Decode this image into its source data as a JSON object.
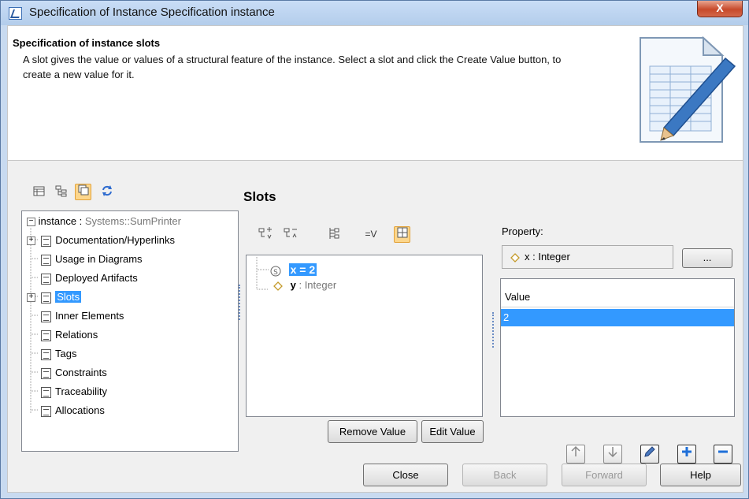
{
  "window": {
    "title": "Specification of Instance Specification instance",
    "close_glyph": "X"
  },
  "header": {
    "title": "Specification of instance slots",
    "description": "A slot gives the value or values of a structural feature of the instance. Select a slot and click the Create Value button, to create a new value for it."
  },
  "toolbar_left": {
    "icons": [
      "table-icon",
      "tree-icon",
      "panel-icon",
      "refresh-icon"
    ]
  },
  "tree": {
    "root_name": "instance",
    "root_sep": " : ",
    "root_type": "Systems::SumPrinter",
    "items": [
      {
        "label": "Documentation/Hyperlinks",
        "expandable": true
      },
      {
        "label": "Usage in Diagrams",
        "expandable": false
      },
      {
        "label": "Deployed Artifacts",
        "expandable": false
      },
      {
        "label": "Slots",
        "expandable": true,
        "selected": true
      },
      {
        "label": "Inner Elements",
        "expandable": false
      },
      {
        "label": "Relations",
        "expandable": false
      },
      {
        "label": "Tags",
        "expandable": false
      },
      {
        "label": "Constraints",
        "expandable": false
      },
      {
        "label": "Traceability",
        "expandable": false
      },
      {
        "label": "Allocations",
        "expandable": false
      }
    ]
  },
  "slots": {
    "title": "Slots",
    "toolbar_value_label": "=V",
    "rows": [
      {
        "name": "x = 2",
        "selected": true
      },
      {
        "name": "y",
        "type": " : Integer"
      }
    ],
    "remove_label": "Remove Value",
    "edit_label": "Edit Value"
  },
  "property": {
    "label": "Property:",
    "value": "x : Integer",
    "browse_label": "..."
  },
  "values_table": {
    "header": "Value",
    "rows": [
      "2"
    ]
  },
  "footer": {
    "close": "Close",
    "back": "Back",
    "forward": "Forward",
    "help": "Help"
  },
  "colors": {
    "selection": "#3399ff",
    "active_toolbar": "#fcd68c"
  }
}
